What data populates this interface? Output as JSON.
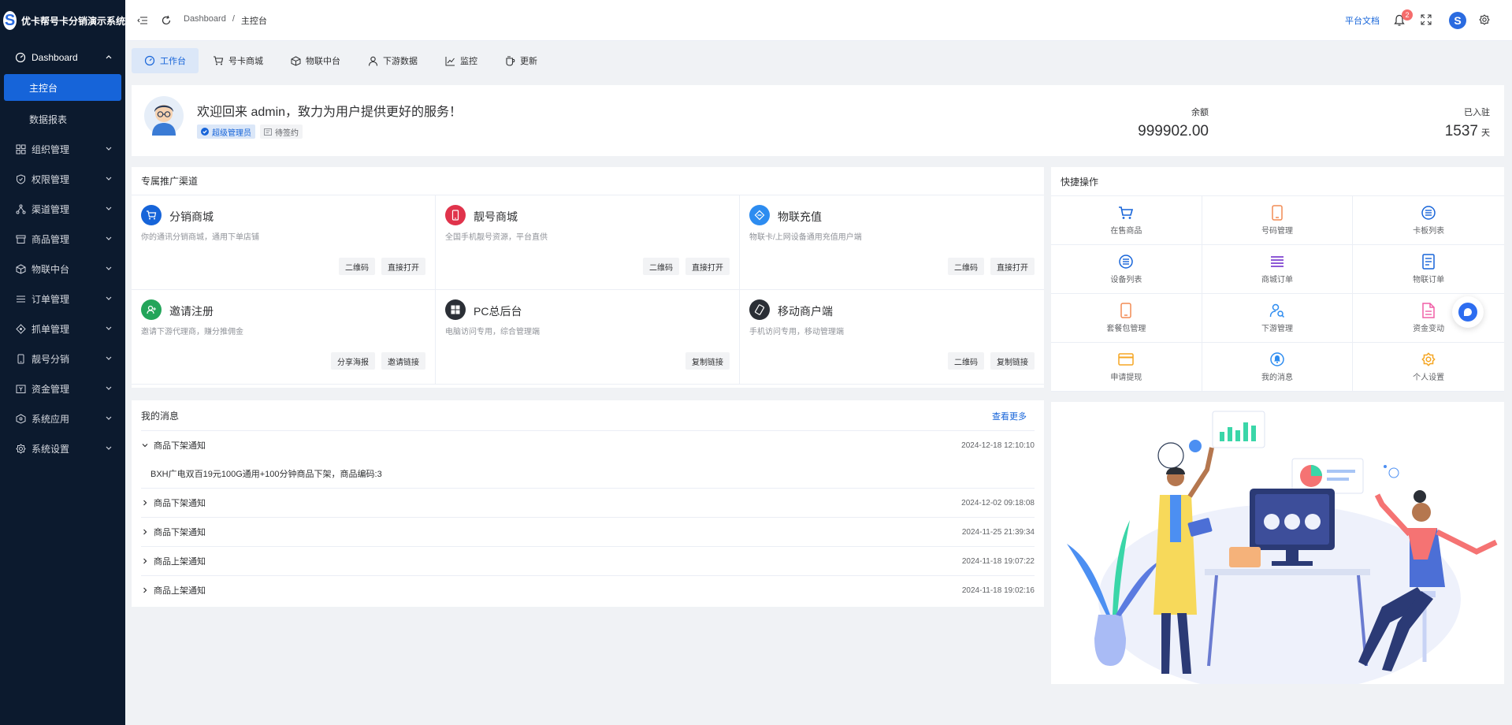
{
  "app": {
    "title": "优卡帮号卡分销演示系统",
    "logo_letter": "S"
  },
  "sidebar": {
    "items": [
      {
        "label": "Dashboard",
        "icon": "dashboard-icon",
        "open": true,
        "children": [
          {
            "label": "主控台",
            "active": true
          },
          {
            "label": "数据报表"
          }
        ]
      },
      {
        "label": "组织管理",
        "icon": "grid-icon"
      },
      {
        "label": "权限管理",
        "icon": "shield-icon"
      },
      {
        "label": "渠道管理",
        "icon": "network-icon"
      },
      {
        "label": "商品管理",
        "icon": "store-icon"
      },
      {
        "label": "物联中台",
        "icon": "cube-icon"
      },
      {
        "label": "订单管理",
        "icon": "list-icon"
      },
      {
        "label": "抓单管理",
        "icon": "diamond-icon"
      },
      {
        "label": "靓号分销",
        "icon": "phone-icon"
      },
      {
        "label": "资金管理",
        "icon": "money-icon"
      },
      {
        "label": "系统应用",
        "icon": "box-icon"
      },
      {
        "label": "系统设置",
        "icon": "gear-icon"
      }
    ]
  },
  "header": {
    "breadcrumb": [
      "Dashboard",
      "主控台"
    ],
    "docs_label": "平台文档",
    "notification_count": "2",
    "avatar_letter": "S"
  },
  "tabs": [
    {
      "label": "工作台",
      "icon": "gauge-icon",
      "active": true
    },
    {
      "label": "号卡商城",
      "icon": "cart-icon"
    },
    {
      "label": "物联中台",
      "icon": "cube-icon"
    },
    {
      "label": "下游数据",
      "icon": "user-icon"
    },
    {
      "label": "监控",
      "icon": "chart-line-icon"
    },
    {
      "label": "更新",
      "icon": "cup-icon"
    }
  ],
  "welcome": {
    "title": "欢迎回来 admin，致力为用户提供更好的服务！",
    "role_badge": "超级管理员",
    "status_badge": "待签约",
    "balance_label": "余额",
    "balance_value": "999902.00",
    "days_label": "已入驻",
    "days_value": "1537",
    "days_unit": "天"
  },
  "promo": {
    "title": "专属推广渠道",
    "cards": [
      {
        "title": "分销商城",
        "desc": "你的通讯分销商城，通用下单店铺",
        "color": "#1664d9",
        "icon": "cart-icon",
        "buttons": [
          "二维码",
          "直接打开"
        ]
      },
      {
        "title": "靓号商城",
        "desc": "全国手机靓号资源，平台直供",
        "color": "#e0334b",
        "icon": "phone-icon",
        "buttons": [
          "二维码",
          "直接打开"
        ]
      },
      {
        "title": "物联充值",
        "desc": "物联卡/上网设备通用充值用户端",
        "color": "#2d8cf0",
        "icon": "link-icon",
        "buttons": [
          "二维码",
          "直接打开"
        ]
      },
      {
        "title": "邀请注册",
        "desc": "邀请下游代理商，赚分推佣金",
        "color": "#23a55a",
        "icon": "invite-icon",
        "buttons": [
          "分享海报",
          "邀请链接"
        ]
      },
      {
        "title": "PC总后台",
        "desc": "电脑访问专用，综合管理端",
        "color": "#2b2f36",
        "icon": "windows-icon",
        "buttons": [
          "复制链接"
        ]
      },
      {
        "title": "移动商户端",
        "desc": "手机访问专用，移动管理端",
        "color": "#2b2f36",
        "icon": "mobile-icon",
        "buttons": [
          "二维码",
          "复制链接"
        ]
      }
    ]
  },
  "quick": {
    "title": "快捷操作",
    "items": [
      {
        "label": "在售商品",
        "icon": "cart-icon",
        "color": "#1664d9"
      },
      {
        "label": "号码管理",
        "icon": "phone-icon",
        "color": "#f28b54"
      },
      {
        "label": "卡板列表",
        "icon": "list-circle-icon",
        "color": "#1664d9"
      },
      {
        "label": "设备列表",
        "icon": "list-circle-icon",
        "color": "#1664d9"
      },
      {
        "label": "商城订单",
        "icon": "lines-icon",
        "color": "#8e5ad6"
      },
      {
        "label": "物联订单",
        "icon": "doc-icon",
        "color": "#1664d9"
      },
      {
        "label": "套餐包管理",
        "icon": "phone-icon",
        "color": "#f28b54"
      },
      {
        "label": "下游管理",
        "icon": "users-icon",
        "color": "#2d8cf0"
      },
      {
        "label": "资金变动",
        "icon": "file-icon",
        "color": "#f05fa6"
      },
      {
        "label": "申请提现",
        "icon": "card-icon",
        "color": "#f5a623"
      },
      {
        "label": "我的消息",
        "icon": "bell-icon",
        "color": "#2d8cf0"
      },
      {
        "label": "个人设置",
        "icon": "gear-icon",
        "color": "#f5a623"
      }
    ]
  },
  "messages": {
    "title": "我的消息",
    "more_label": "查看更多",
    "items": [
      {
        "title": "商品下架通知",
        "date": "2024-12-18 12:10:10",
        "expanded": true,
        "content": "BXH广电双百19元100G通用+100分钟商品下架，商品编码:3"
      },
      {
        "title": "商品下架通知",
        "date": "2024-12-02 09:18:08"
      },
      {
        "title": "商品下架通知",
        "date": "2024-11-25 21:39:34"
      },
      {
        "title": "商品上架通知",
        "date": "2024-11-18 19:07:22"
      },
      {
        "title": "商品上架通知",
        "date": "2024-11-18 19:02:16"
      }
    ]
  }
}
